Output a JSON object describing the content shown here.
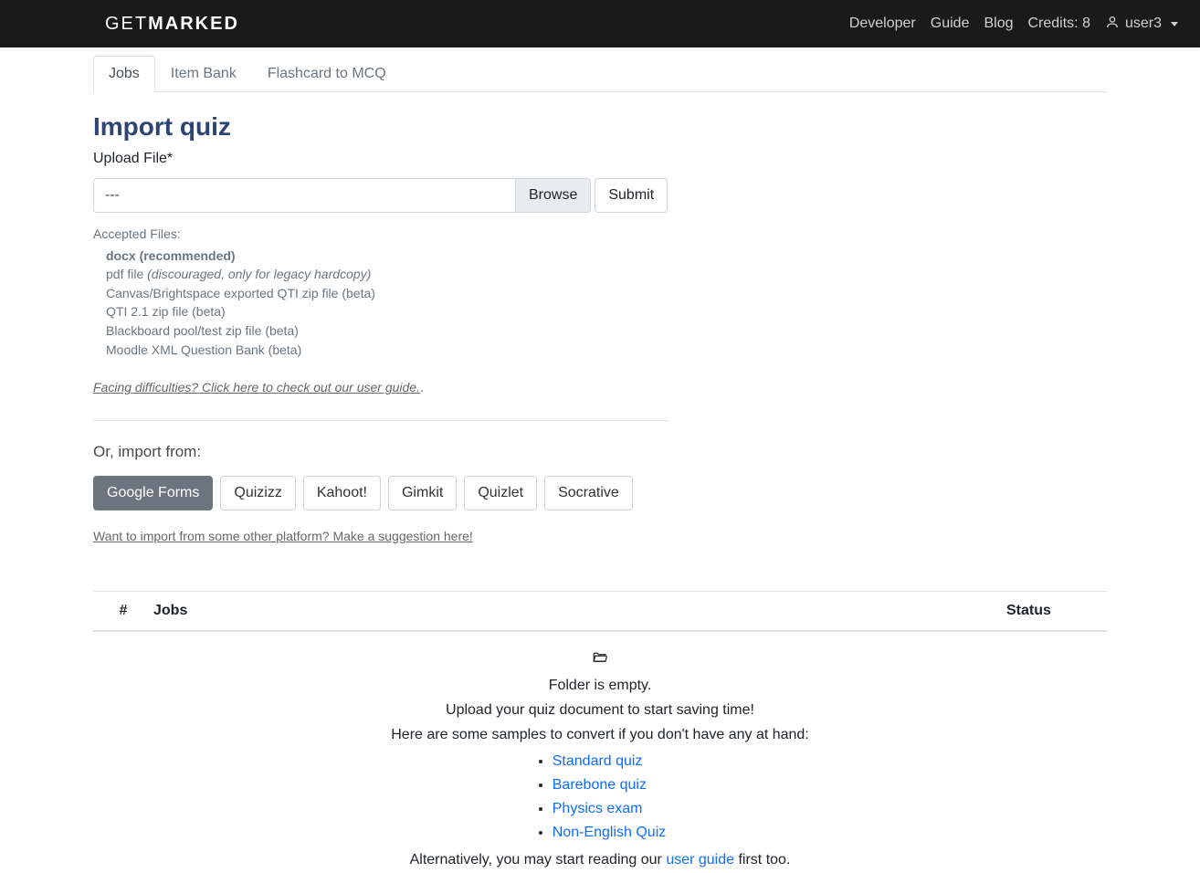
{
  "brand": {
    "thin": "GET",
    "bold": "MARKED"
  },
  "nav": {
    "developer": "Developer",
    "guide": "Guide",
    "blog": "Blog",
    "credits": "Credits: 8",
    "user": "user3"
  },
  "tabs": [
    {
      "label": "Jobs",
      "active": true
    },
    {
      "label": "Item Bank",
      "active": false
    },
    {
      "label": "Flashcard to MCQ",
      "active": false
    }
  ],
  "page": {
    "title": "Import quiz",
    "upload_label": "Upload File*",
    "file_value": "---",
    "browse": "Browse",
    "submit": "Submit",
    "accepted_heading": "Accepted Files:",
    "accepted_items": {
      "docx": "docx (recommended)",
      "pdf_prefix": "pdf file ",
      "pdf_note": "(discouraged, only for legacy hardcopy)",
      "canvas": "Canvas/Brightspace exported QTI zip file (beta)",
      "qti": "QTI 2.1 zip file (beta)",
      "bb": "Blackboard pool/test zip file (beta)",
      "moodle": "Moodle XML Question Bank (beta)"
    },
    "help_link": "Facing difficulties? Click here to check out our user guide.",
    "help_link_suffix": ".",
    "import_from": "Or, import from:",
    "chips": [
      "Google Forms",
      "Quizizz",
      "Kahoot!",
      "Gimkit",
      "Quizlet",
      "Socrative"
    ],
    "suggest": "Want to import from some other platform? Make a suggestion here!"
  },
  "table": {
    "col_num": "#",
    "col_jobs": "Jobs",
    "col_status": "Status"
  },
  "empty": {
    "line1": "Folder is empty.",
    "line2": "Upload your quiz document to start saving time!",
    "line3": "Here are some samples to convert if you don't have any at hand:",
    "samples": [
      "Standard quiz",
      "Barebone quiz",
      "Physics exam",
      "Non-English Quiz"
    ],
    "alt_prefix": "Alternatively, you may start reading our ",
    "alt_link": "user guide",
    "alt_suffix": " first too."
  }
}
